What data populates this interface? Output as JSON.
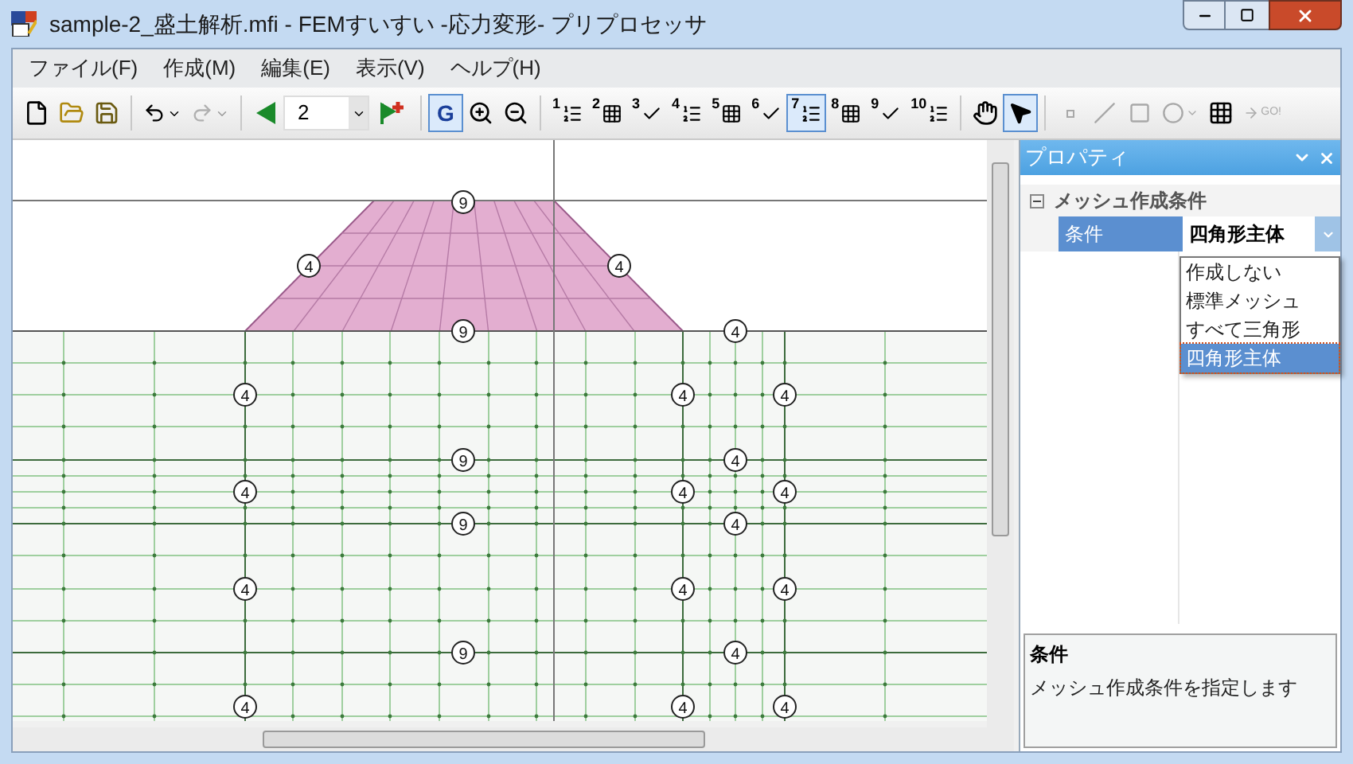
{
  "window": {
    "title": "sample-2_盛土解析.mfi - FEMすいすい -応力変形- プリプロセッサ"
  },
  "menu": [
    "ファイル(F)",
    "作成(M)",
    "編集(E)",
    "表示(V)",
    "ヘルプ(H)"
  ],
  "toolbar": {
    "redo_disabled": true,
    "step_value": "2",
    "grid_button": {
      "label": "G",
      "selected": true
    },
    "steps": [
      {
        "label": "1",
        "selected": false
      },
      {
        "label": "2",
        "selected": false
      },
      {
        "label": "3",
        "selected": false
      },
      {
        "label": "4",
        "selected": false
      },
      {
        "label": "5",
        "selected": false
      },
      {
        "label": "6",
        "selected": false
      },
      {
        "label": "7",
        "selected": true
      },
      {
        "label": "8",
        "selected": false
      },
      {
        "label": "9",
        "selected": false
      },
      {
        "label": "10",
        "selected": false
      }
    ],
    "pan_selected": false,
    "pointer_selected": true,
    "draw_tools_disabled": true,
    "go_label": "GO!"
  },
  "canvas": {
    "labels": [
      "9",
      "4",
      "4",
      "9",
      "4",
      "4",
      "4",
      "4",
      "9",
      "4",
      "4",
      "4",
      "4",
      "9",
      "4",
      "4",
      "4",
      "4",
      "9",
      "4",
      "4",
      "4",
      "4"
    ]
  },
  "properties": {
    "title": "プロパティ",
    "category": {
      "name": "メッシュ作成条件",
      "expanded": true
    },
    "row": {
      "name": "条件",
      "value": "四角形主体",
      "selected": true
    },
    "dropdown": {
      "open": true,
      "options": [
        {
          "label": "作成しない",
          "selected": false
        },
        {
          "label": "標準メッシュ",
          "selected": false
        },
        {
          "label": "すべて三角形",
          "selected": false
        },
        {
          "label": "四角形主体",
          "selected": true
        }
      ]
    },
    "description": {
      "title": "条件",
      "text": "メッシュ作成条件を指定します"
    }
  }
}
